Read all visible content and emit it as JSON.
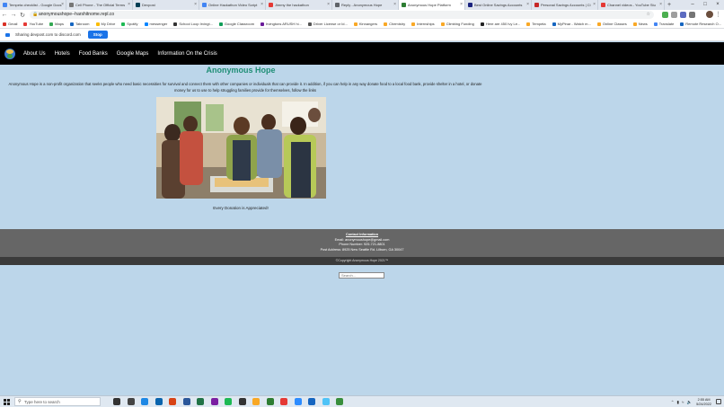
{
  "browser": {
    "tabs": [
      {
        "title": "Tempeta checklist - Google Docs",
        "color": "#4285f4",
        "active": false
      },
      {
        "title": "Cell Phone - The Official Terms",
        "color": "#777777",
        "active": false
      },
      {
        "title": "Devpost",
        "color": "#003e54",
        "active": false
      },
      {
        "title": "Online Hackathon Video Script",
        "color": "#4285f4",
        "active": false
      },
      {
        "title": "Jimmy the hackathon",
        "color": "#e53935",
        "active": false
      },
      {
        "title": "Reply - Anonymous Hope",
        "color": "#5f6368",
        "active": false
      },
      {
        "title": "Anonymous Hope Platform",
        "color": "#2e7d32",
        "active": true
      },
      {
        "title": "Best Online Savings Accounts",
        "color": "#1a237e",
        "active": false
      },
      {
        "title": "Personal Savings Accounts | Ci",
        "color": "#c62828",
        "active": false
      },
      {
        "title": "Channel videos - YouTube Stu",
        "color": "#e53935",
        "active": false
      }
    ],
    "url": "anonymoushope--harshitnome.repl.co",
    "bookmarks": [
      {
        "label": "Gmail",
        "color": "#d93025"
      },
      {
        "label": "YouTube",
        "color": "#e53935"
      },
      {
        "label": "Maps",
        "color": "#34a853"
      },
      {
        "label": "Tabroom",
        "color": "#1565c0"
      },
      {
        "label": "My Drive",
        "color": "#fbbc04"
      },
      {
        "label": "Spotify",
        "color": "#1db954"
      },
      {
        "label": "messenger",
        "color": "#0084ff"
      },
      {
        "label": "School Loop Irvingt...",
        "color": "#333333"
      },
      {
        "label": "Google Classroom",
        "color": "#0f9d58"
      },
      {
        "label": "Irvingtons ARUSH hi...",
        "color": "#6a1b9a"
      },
      {
        "label": "Driver License or Id...",
        "color": "#555555"
      },
      {
        "label": "Kinnangers",
        "color": "#f9a825"
      },
      {
        "label": "Chemistry",
        "color": "#f9a825"
      },
      {
        "label": "Internships",
        "color": "#f9a825"
      },
      {
        "label": "Climbing Funding",
        "color": "#f9a825"
      },
      {
        "label": "Here are 450 Ivy Le...",
        "color": "#222222"
      },
      {
        "label": "Tempeta",
        "color": "#f9a825"
      },
      {
        "label": "MyPinar - Watch m...",
        "color": "#1565c0"
      },
      {
        "label": "Online Classes",
        "color": "#f9a825"
      },
      {
        "label": "News",
        "color": "#f9a825"
      },
      {
        "label": "Translate",
        "color": "#4285f4"
      },
      {
        "label": "Remote Research O...",
        "color": "#1565c0"
      }
    ],
    "sharing_text": "Sharing devpost.com to discord.com",
    "stop_label": "Stop"
  },
  "site": {
    "nav": [
      "About Us",
      "Hotels",
      "Food Banks",
      "Google Maps",
      "Information On the Crisis"
    ],
    "title": "Anonymous Hope",
    "intro": "Anonymous Hope is a non-profit organization that seeks people who need basic necessities for survival and connect them with other companies or individuals that can provide it. In addition, if you can help in any way donate food to a local food bank, provide shelter in a hotel, or donate money for us to use to help struggling families provide for themselves, follow the links",
    "caption": "Every Donation is Appreciated!",
    "footer": {
      "heading": "Contact Information",
      "email": "Email: anonymoushope@gmail.com",
      "phone": "Phone Number: 925-721-8801",
      "address": "Post Address: 8925 New Seattle Rd. Lilburn, GA 30047"
    },
    "copyright": "©Copyright Anonymous Hope 2021™",
    "search_placeholder": "Search..."
  },
  "taskbar": {
    "search_placeholder": "Type here to search",
    "apps": [
      {
        "name": "cortana-icon",
        "color": "#333333"
      },
      {
        "name": "task-view-icon",
        "color": "#444444"
      },
      {
        "name": "edge-icon",
        "color": "#1e88e5"
      },
      {
        "name": "mail-icon",
        "color": "#0a64ad"
      },
      {
        "name": "office-icon",
        "color": "#d84315"
      },
      {
        "name": "word-icon",
        "color": "#2b579a"
      },
      {
        "name": "excel-icon",
        "color": "#217346"
      },
      {
        "name": "app-icon-purple",
        "color": "#7b1fa2"
      },
      {
        "name": "spotify-icon",
        "color": "#1db954"
      },
      {
        "name": "terminal-icon",
        "color": "#333333"
      },
      {
        "name": "file-explorer-icon",
        "color": "#f9a825"
      },
      {
        "name": "app-icon-green",
        "color": "#2e7d32"
      },
      {
        "name": "chrome-icon",
        "color": "#e53935"
      },
      {
        "name": "zoom-icon",
        "color": "#2d8cff"
      },
      {
        "name": "app-icon-blue",
        "color": "#1565c0"
      },
      {
        "name": "photos-icon",
        "color": "#4fc3f7"
      },
      {
        "name": "pin-icon",
        "color": "#388e3c"
      }
    ],
    "time": "2:55 AM",
    "date": "5/24/2022"
  }
}
